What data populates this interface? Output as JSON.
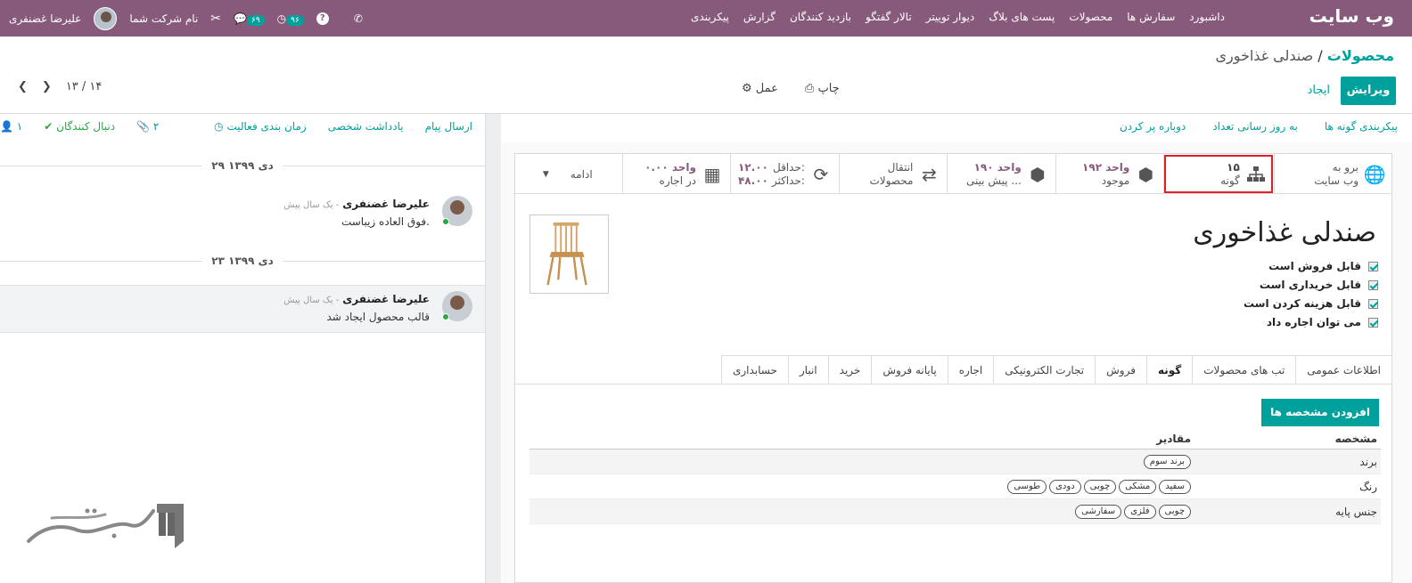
{
  "topbar": {
    "brand": "وب سایت",
    "menu": [
      "داشبورد",
      "سفارش ها",
      "محصولات",
      "پست های بلاگ",
      "دیوار توییتر",
      "تالار گفتگو",
      "بازدید کنندگان",
      "گزارش",
      "پیکربندی"
    ],
    "user_name": "علیرضا غضنفری",
    "company": "نام شرکت شما",
    "badge_messages": "۶۹",
    "badge_activities": "۹۶"
  },
  "breadcrumb": {
    "parent": "محصولات",
    "separator": "/",
    "current": "صندلی غذاخوری"
  },
  "actions": {
    "edit": "ویرایش",
    "create": "ایجاد",
    "print": "چاپ",
    "action": "عمل"
  },
  "pager": {
    "value": "۱۳ / ۱۴"
  },
  "form_toolbar": [
    "پیکربندی گونه ها",
    "به روز رسانی تعداد",
    "دوباره پر کردن"
  ],
  "smart_buttons": {
    "website": {
      "line1": "برو به",
      "line2": "وب سایت"
    },
    "variants": {
      "value": "۱۵",
      "label": "گونه"
    },
    "onhand": {
      "value": "۱۹۲ واحد",
      "label": "موجود"
    },
    "forecast": {
      "value": "۱۹۰ واحد",
      "label": "پیش بینی ..."
    },
    "transfer": {
      "line1": "انتقال",
      "line2": "محصولات"
    },
    "minmax": {
      "min_label": "حداقل:",
      "min": "۱۲.۰۰",
      "max_label": "حداکثر:",
      "max": "۴۸.۰۰"
    },
    "rental": {
      "value": "۰.۰۰ واحد",
      "label": "در اجاره"
    },
    "more": "ادامه"
  },
  "product": {
    "name": "صندلی غذاخوری",
    "flags": [
      "قابل فروش است",
      "قابل خریداری است",
      "قابل هزینه کردن است",
      "می توان اجاره داد"
    ]
  },
  "tabs": [
    "اطلاعات عمومی",
    "تب های محصولات",
    "گونه",
    "فروش",
    "تجارت الکترونیکی",
    "اجاره",
    "پایانه فروش",
    "خرید",
    "انبار",
    "حسابداری"
  ],
  "attributes": {
    "add_button": "افزودن مشخصه ها",
    "col_attribute": "مشخصه",
    "col_values": "مقادیر",
    "rows": [
      {
        "name": "برند",
        "values": [
          "برند سوم"
        ]
      },
      {
        "name": "رنگ",
        "values": [
          "سفید",
          "مشکی",
          "چوبی",
          "دودی",
          "طوسی"
        ]
      },
      {
        "name": "جنس پایه",
        "values": [
          "چوبی",
          "فلزی",
          "سفارشی"
        ]
      }
    ]
  },
  "chatter": {
    "send_message": "ارسال پیام",
    "log_note": "یادداشت شخصی",
    "schedule": "زمان بندی فعالیت",
    "attachments": "۲",
    "following": "دنبال کنندگان",
    "followers": "۱",
    "dates": [
      "۲۹ دی ۱۳۹۹",
      "۲۳ دی ۱۳۹۹"
    ],
    "messages": [
      {
        "author": "علیرضا غضنفری",
        "ago": "- یک سال پیش",
        "body": "فوق العاده زیباست."
      },
      {
        "author": "علیرضا غضنفری",
        "ago": "- یک سال پیش",
        "body": "قالب محصول ایجاد شد"
      }
    ]
  },
  "colors": {
    "brand": "#875a7b",
    "accent": "#00a09d",
    "highlight": "#e01f26"
  }
}
